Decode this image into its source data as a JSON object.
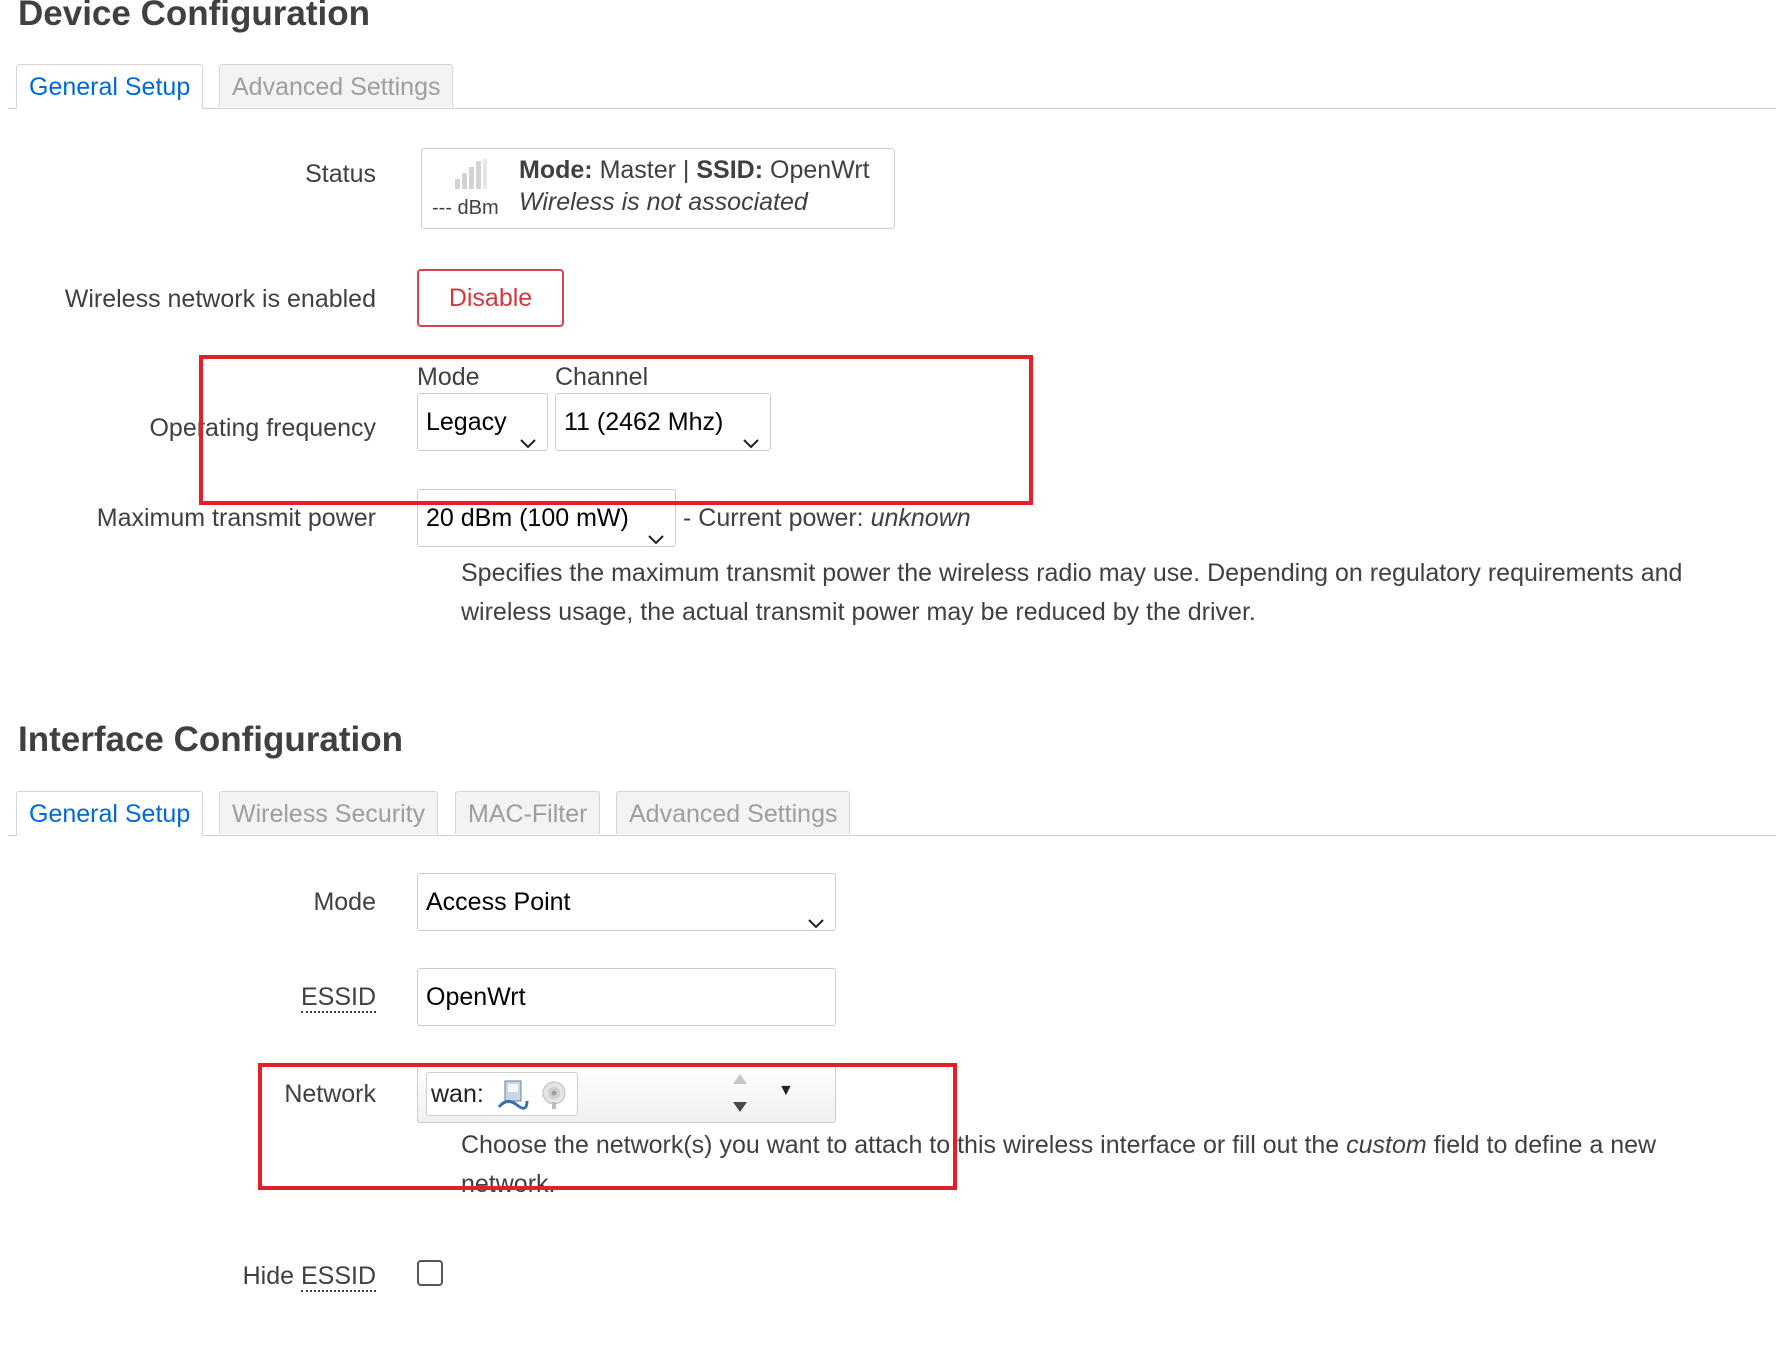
{
  "device": {
    "title": "Device Configuration",
    "tabs": [
      "General Setup",
      "Advanced Settings"
    ],
    "status": {
      "label": "Status",
      "signal": "--- dBm",
      "mode_key": "Mode:",
      "mode_val": "Master",
      "separator": "|",
      "ssid_key": "SSID:",
      "ssid_val": "OpenWrt",
      "assoc": "Wireless is not associated"
    },
    "enabled": {
      "label": "Wireless network is enabled",
      "button": "Disable"
    },
    "freq": {
      "label": "Operating frequency",
      "mode_header": "Mode",
      "channel_header": "Channel",
      "mode_value": "Legacy",
      "channel_value": "11 (2462 Mhz)"
    },
    "txpower": {
      "label": "Maximum transmit power",
      "value": "20 dBm (100 mW)",
      "current_prefix": "- Current power:",
      "current_value": "unknown",
      "help_line1": "Specifies the maximum transmit power the wireless radio may use. Depending on regulatory requirements and",
      "help_line2": "wireless usage, the actual transmit power may be reduced by the driver."
    }
  },
  "iface": {
    "title": "Interface Configuration",
    "tabs": [
      "General Setup",
      "Wireless Security",
      "MAC-Filter",
      "Advanced Settings"
    ],
    "mode": {
      "label": "Mode",
      "value": "Access Point"
    },
    "essid": {
      "label": "ESSID",
      "value": "OpenWrt"
    },
    "network": {
      "label": "Network",
      "chip": "wan:",
      "help_prefix": "Choose the network(s) you want to attach to this wireless interface or fill out the",
      "help_em": "custom",
      "help_suffix": "field to define a new",
      "help_line2": "network."
    },
    "hide": {
      "label_prefix": "Hide",
      "label_abbr": "ESSID",
      "checked": false
    }
  },
  "colors": {
    "accent": "#0069d6",
    "danger": "#d9444b",
    "highlight": "#e0212c"
  }
}
